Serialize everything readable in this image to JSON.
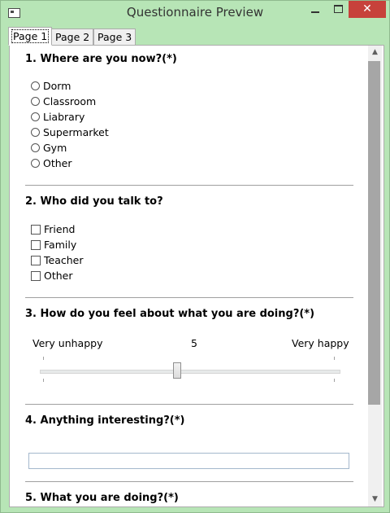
{
  "window": {
    "title": "Questionnaire Preview",
    "close_glyph": "✕"
  },
  "tabs": [
    {
      "label": "Page 1",
      "active": true
    },
    {
      "label": "Page 2",
      "active": false
    },
    {
      "label": "Page 3",
      "active": false
    }
  ],
  "questions": {
    "q1": {
      "title": "1. Where are you now?(*)",
      "options": [
        "Dorm",
        "Classroom",
        "Liabrary",
        "Supermarket",
        "Gym",
        "Other"
      ]
    },
    "q2": {
      "title": "2. Who did you talk to?",
      "options": [
        "Friend",
        "Family",
        "Teacher",
        "Other"
      ]
    },
    "q3": {
      "title": "3. How do you feel about what you are doing?(*)",
      "min_label": "Very unhappy",
      "value": "5",
      "max_label": "Very happy"
    },
    "q4": {
      "title": "4. Anything interesting?(*)",
      "value": ""
    },
    "q5": {
      "title": "5. What you are doing?(*)"
    }
  },
  "scrollbar": {
    "up_glyph": "▲",
    "down_glyph": "▼",
    "visible_fraction": 0.78,
    "position_fraction": 0.0
  },
  "icons": {
    "app": "window-app-icon",
    "minimize": "minimize-icon",
    "maximize": "maximize-icon",
    "close": "close-icon"
  },
  "colors": {
    "frame": "#b7e5b6",
    "close_button": "#c7413b",
    "scroll_thumb": "#a6a6a6"
  }
}
